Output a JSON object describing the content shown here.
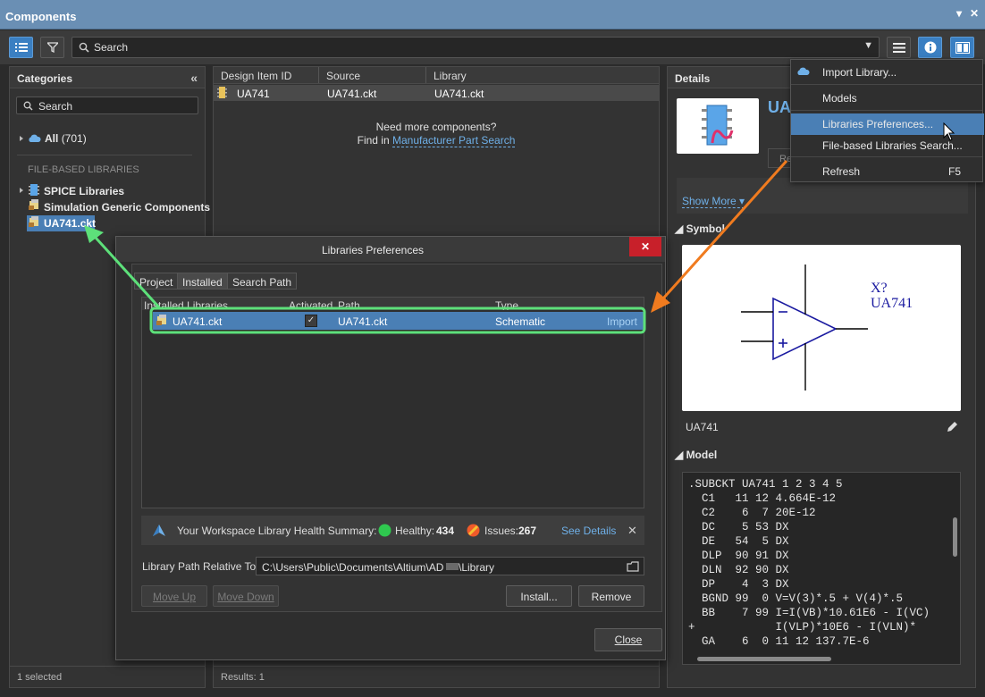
{
  "window": {
    "title": "Components"
  },
  "toolbar": {
    "search_placeholder": "Search"
  },
  "categories": {
    "header": "Categories",
    "search_placeholder": "Search",
    "all_label": "All",
    "all_count": "(701)",
    "section": "FILE-BASED LIBRARIES",
    "items": [
      "SPICE Libraries",
      "Simulation Generic Components",
      "UA741.ckt"
    ],
    "status": "1 selected"
  },
  "list": {
    "columns": [
      "Design Item ID",
      "Source",
      "Library"
    ],
    "row": {
      "id": "UA741",
      "source": "UA741.ckt",
      "library": "UA741.ckt"
    },
    "more_text": "Need more components?",
    "find_in": "Find in",
    "link": "Manufacturer Part Search",
    "status": "Results: 1"
  },
  "details": {
    "header": "Details",
    "name_partial": "UA",
    "btn_partial": "Re",
    "show_more": "Show More ▾",
    "symbol_header": "Symbol",
    "symbol_designator": "X?",
    "symbol_comment": "UA741",
    "symbol_name": "UA741",
    "model_header": "Model",
    "model_lines": [
      ".SUBCKT UA741 1 2 3 4 5",
      "  C1   11 12 4.664E-12",
      "  C2    6  7 20E-12",
      "  DC    5 53 DX",
      "  DE   54  5 DX",
      "  DLP  90 91 DX",
      "  DLN  92 90 DX",
      "  DP    4  3 DX",
      "  BGND 99  0 V=V(3)*.5 + V(4)*.5",
      "  BB    7 99 I=I(VB)*10.61E6 - I(VC)",
      "+            I(VLP)*10E6 - I(VLN)*",
      "  GA    6  0 11 12 137.7E-6"
    ]
  },
  "menu": {
    "items": [
      {
        "label": "Import Library...",
        "shortcut": ""
      },
      {
        "label": "Models",
        "shortcut": ""
      },
      {
        "label": "Libraries Preferences...",
        "shortcut": ""
      },
      {
        "label": "File-based Libraries Search...",
        "shortcut": ""
      },
      {
        "label": "Refresh",
        "shortcut": "F5"
      }
    ]
  },
  "dialog": {
    "title": "Libraries Preferences",
    "tabs": [
      "Project",
      "Installed",
      "Search Path"
    ],
    "columns": [
      "Installed Libraries",
      "Activated",
      "Path",
      "Type"
    ],
    "row": {
      "name": "UA741.ckt",
      "path": "UA741.ckt",
      "type": "Schematic",
      "action": "Import"
    },
    "health_label": "Your Workspace Library Health Summary:",
    "healthy_label": "Healthy:",
    "healthy_count": "434",
    "issues_label": "Issues:",
    "issues_count": "267",
    "see_details": "See Details",
    "path_label": "Library Path Relative To:",
    "path_value": "C:\\Users\\Public\\Documents\\Altium\\AD",
    "path_suffix": "\\Library",
    "btn_move_up": "Move Up",
    "btn_move_down": "Move Down",
    "btn_install": "Install...",
    "btn_remove": "Remove",
    "btn_close": "Close"
  },
  "colors": {
    "accent": "#4a7fb5",
    "highlight_green": "#5de07a",
    "arrow_orange": "#f07b1f",
    "healthy": "#2fc84f",
    "issues": "#f05a2a"
  }
}
